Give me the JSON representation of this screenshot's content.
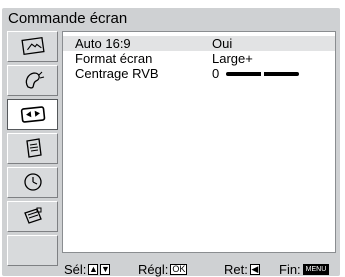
{
  "header": {
    "title": "Commande écran"
  },
  "sidebar": {
    "items": [
      {
        "icon": "picture-icon",
        "selected": false
      },
      {
        "icon": "sound-icon",
        "selected": false
      },
      {
        "icon": "screen-icon",
        "selected": true
      },
      {
        "icon": "features-icon",
        "selected": false
      },
      {
        "icon": "timer-icon",
        "selected": false
      },
      {
        "icon": "setup-icon",
        "selected": false
      },
      {
        "icon": "empty",
        "selected": false
      }
    ]
  },
  "settings": [
    {
      "label": "Auto 16:9",
      "value": "Oui"
    },
    {
      "label": "Format écran",
      "value": "Large+"
    },
    {
      "label": "Centrage RVB",
      "value": "0",
      "slider_level": 0.5
    }
  ],
  "footer": {
    "select_label": "Sél:",
    "adjust_label": "Régl:",
    "adjust_key": "OK",
    "return_label": "Ret:",
    "end_label": "Fin:",
    "end_key": "MENU"
  },
  "colors": {
    "background": "#cfd1d3",
    "panel": "#ffffff",
    "highlight": "#e2e3e4",
    "text": "#000000"
  }
}
